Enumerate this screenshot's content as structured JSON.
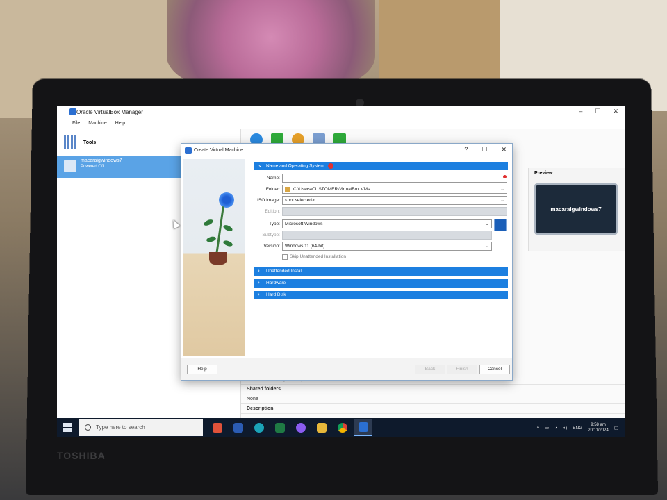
{
  "main_window": {
    "title": "Oracle VirtualBox Manager",
    "controls": [
      "–",
      "☐",
      "✕"
    ],
    "menu": [
      "File",
      "Machine",
      "Help"
    ],
    "tools_label": "Tools",
    "vm": {
      "name": "macaraigwindows7",
      "status": "Powered Off"
    },
    "preview": {
      "label": "Preview",
      "screen_text": "macaraigwindows7"
    },
    "details": [
      {
        "text": "Device Filters:     0 (0 active)",
        "head": false
      },
      {
        "text": "Shared folders",
        "head": true
      },
      {
        "text": "None",
        "head": false
      },
      {
        "text": "Description",
        "head": true
      }
    ]
  },
  "dialog": {
    "title": "Create Virtual Machine",
    "controls": [
      "?",
      "☐",
      "✕"
    ],
    "section_main": "Name and Operating System",
    "fields": {
      "name_label": "Name:",
      "name_value": "",
      "folder_label": "Folder:",
      "folder_value": "C:\\Users\\CUSTOMER\\VirtualBox VMs",
      "iso_label": "ISO Image:",
      "iso_value": "<not selected>",
      "edition_label": "Edition:",
      "type_label": "Type:",
      "type_value": "Microsoft Windows",
      "subtype_label": "Subtype:",
      "version_label": "Version:",
      "version_value": "Windows 11 (64-bit)",
      "skip_label": "Skip Unattended Installation"
    },
    "sections_collapsed": [
      "Unattended Install",
      "Hardware",
      "Hard Disk"
    ],
    "buttons": {
      "help": "Help",
      "back": "Back",
      "finish": "Finish",
      "cancel": "Cancel"
    }
  },
  "taskbar": {
    "search_placeholder": "Type here to search",
    "apps": [
      "snipping-tool",
      "word",
      "edge",
      "excel",
      "messenger",
      "file-explorer",
      "chrome",
      "virtualbox"
    ],
    "tray_lang": "ENG",
    "time": "9:58 am",
    "date": "20/11/2024"
  },
  "laptop_brand": "TOSHIBA",
  "colors": {
    "accent": "#1c7fe0",
    "selection": "#5aa3e6",
    "taskbar": "#0e1a2c",
    "warning": "#e03030"
  }
}
